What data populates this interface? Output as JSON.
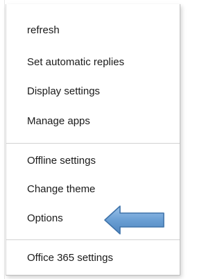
{
  "menu": {
    "items": [
      {
        "label": "refresh"
      },
      {
        "label": "Set automatic replies"
      },
      {
        "label": "Display settings"
      },
      {
        "label": "Manage apps"
      },
      {
        "label": "Offline settings"
      },
      {
        "label": "Change theme"
      },
      {
        "label": "Options"
      },
      {
        "label": "Office 365 settings"
      }
    ]
  },
  "annotation": {
    "arrow_icon": "left-arrow-icon",
    "arrow_color": "#6a9fd4",
    "arrow_border": "#3f73aa"
  }
}
